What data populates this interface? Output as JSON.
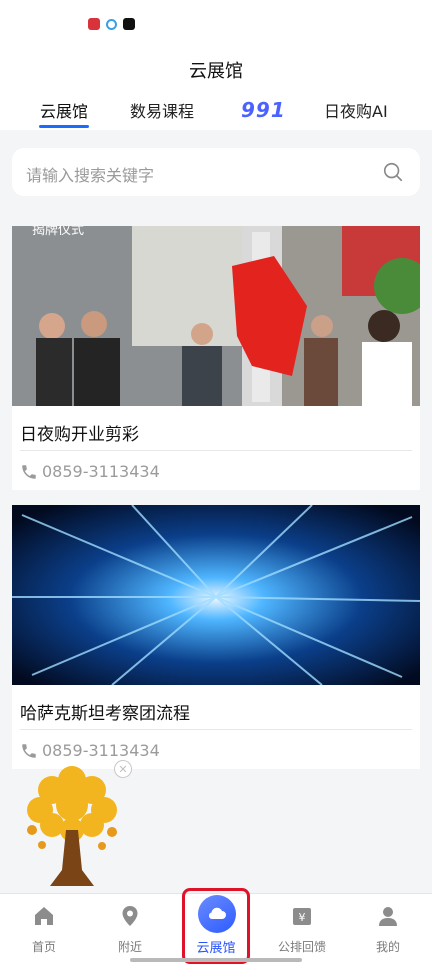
{
  "header": {
    "title": "云展馆"
  },
  "tabs": [
    {
      "label": "云展馆",
      "active": true
    },
    {
      "label": "数易课程",
      "active": false
    },
    {
      "label": "991",
      "active": false
    },
    {
      "label": "日夜购AI",
      "active": false
    }
  ],
  "search": {
    "placeholder": "请输入搜索关键字"
  },
  "cards": [
    {
      "title": "日夜购开业剪彩",
      "phone": "0859-3113434",
      "image_text": "揭牌仪式"
    },
    {
      "title": "哈萨克斯坦考察团流程",
      "phone": "0859-3113434"
    }
  ],
  "bottom_nav": [
    {
      "label": "首页",
      "icon": "home-icon"
    },
    {
      "label": "附近",
      "icon": "location-pin-icon"
    },
    {
      "label": "云展馆",
      "icon": "cloud-icon",
      "active": true
    },
    {
      "label": "公排回馈",
      "icon": "yen-wallet-icon"
    },
    {
      "label": "我的",
      "icon": "user-icon"
    }
  ],
  "colors": {
    "accent": "#1a6cff",
    "highlight_box": "#e0122a",
    "nav_active": "#2a55ff"
  }
}
